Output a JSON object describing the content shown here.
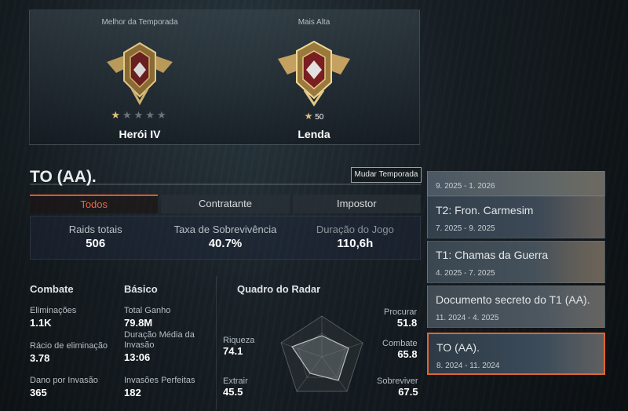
{
  "rank": {
    "best": {
      "caption": "Melhor da Temporada",
      "name": "Herói IV",
      "stars_filled": 1,
      "stars_total": 5
    },
    "highest": {
      "caption": "Mais Alta",
      "name": "Lenda",
      "star_count": "50"
    }
  },
  "season": {
    "title": "TO (AA).",
    "change_button": "Mudar Temporada"
  },
  "tabs": [
    {
      "label": "Todos",
      "active": true
    },
    {
      "label": "Contratante",
      "active": false
    },
    {
      "label": "Impostor",
      "active": false
    }
  ],
  "summary": [
    {
      "label": "Raids totais",
      "value": "506"
    },
    {
      "label": "Taxa de Sobrevivência",
      "value": "40.7%"
    },
    {
      "label": "Duração do Jogo",
      "value": "110,6h"
    }
  ],
  "combat": {
    "heading": "Combate",
    "items": [
      {
        "label": "Eliminações",
        "value": "1.1K"
      },
      {
        "label": "Rácio de eliminação",
        "value": "3.78"
      },
      {
        "label": "Dano por Invasão",
        "value": "365"
      }
    ]
  },
  "basic": {
    "heading": "Básico",
    "items": [
      {
        "label": "Total Ganho",
        "value": "79.8M"
      },
      {
        "label": "Duração Média da Invasão",
        "value": "13:06"
      },
      {
        "label": "Invasões Perfeitas",
        "value": "182"
      }
    ]
  },
  "radar": {
    "heading": "Quadro do Radar",
    "axes": [
      {
        "label": "Procurar",
        "value": "51.8"
      },
      {
        "label": "Combate",
        "value": "65.8"
      },
      {
        "label": "Sobreviver",
        "value": "67.5"
      },
      {
        "label": "Extrair",
        "value": "45.5"
      },
      {
        "label": "Riqueza",
        "value": "74.1"
      }
    ]
  },
  "seasons": [
    {
      "name": "",
      "dates": "9. 2025  -  1. 2026",
      "selected": false
    },
    {
      "name": "T2: Fron. Carmesim",
      "dates": "7. 2025  -  9. 2025",
      "selected": false
    },
    {
      "name": "T1: Chamas da Guerra",
      "dates": "4. 2025  -  7. 2025",
      "selected": false
    },
    {
      "name": "Documento secreto do T1 (AA).",
      "dates": "11. 2024  -  4. 2025",
      "selected": false
    },
    {
      "name": "TO (AA).",
      "dates": "8. 2024  -  11. 2024",
      "selected": true
    }
  ],
  "colors": {
    "accent": "#e0662f",
    "gold": "#e0c27a"
  }
}
